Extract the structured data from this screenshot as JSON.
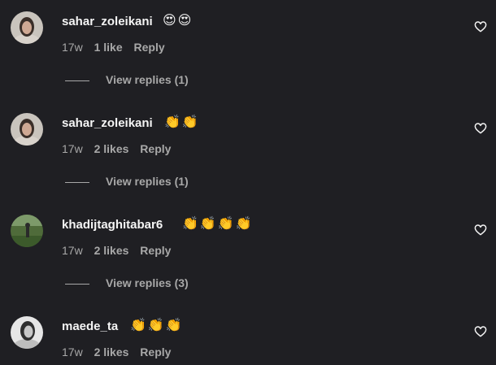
{
  "comments": [
    {
      "username": "sahar_zoleikani",
      "emojis": "😍😍",
      "age": "17w",
      "likes": "1 like",
      "reply_label": "Reply",
      "view_replies": "View replies (1)"
    },
    {
      "username": "sahar_zoleikani",
      "emojis": "👏👏",
      "age": "17w",
      "likes": "2 likes",
      "reply_label": "Reply",
      "view_replies": "View replies (1)"
    },
    {
      "username": "khadijtaghitabar6",
      "emojis": "👏👏👏👏",
      "age": "17w",
      "likes": "2 likes",
      "reply_label": "Reply",
      "view_replies": "View replies (3)"
    },
    {
      "username": "maede_ta",
      "emojis": "👏👏👏",
      "age": "17w",
      "likes": "2 likes",
      "reply_label": "Reply"
    }
  ],
  "icons": {
    "like": "heart-outline-icon",
    "avatar": "avatar"
  },
  "colors": {
    "background": "#1f1f23",
    "primary_text": "#f5f5f5",
    "secondary_text": "#a8a8a8"
  }
}
